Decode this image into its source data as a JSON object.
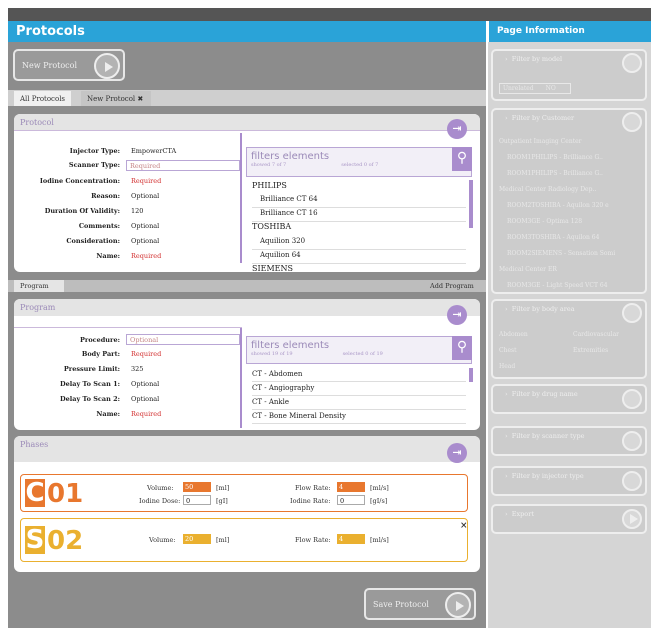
{
  "header": {
    "title": "Protocols",
    "side_title": "Page Information"
  },
  "toolbar": {
    "new_protocol": "New Protocol",
    "save_protocol": "Save Protocol"
  },
  "tabs": {
    "all": "All Protocols",
    "new": "New Protocol",
    "close": "✖",
    "program": "Program",
    "add_program": "Add Program"
  },
  "protocol": {
    "section_title": "Protocol",
    "fields": [
      {
        "label": "Injector Type:",
        "value": "EmpowerCTA"
      },
      {
        "label": "Scanner Type:",
        "value": "Required"
      },
      {
        "label": "Iodine Concentration:",
        "value": "Required"
      },
      {
        "label": "Reason:",
        "value": "Optional"
      },
      {
        "label": "Duration Of Validity:",
        "value": "120"
      },
      {
        "label": "Comments:",
        "value": "Optional"
      },
      {
        "label": "Consideration:",
        "value": "Optional"
      },
      {
        "label": "Name:",
        "value": "Required"
      }
    ],
    "filter": {
      "title": "filters elements",
      "showed": "showed 7 of 7",
      "selected": "selected 0 of 7"
    },
    "list": [
      "PHILIPS",
      "Brilliance CT 64",
      "Brilliance CT 16",
      "TOSHIBA",
      "Aquilion 320",
      "Aquilion 64",
      "SIEMENS"
    ]
  },
  "program": {
    "section_title": "Program",
    "fields": [
      {
        "label": "Procedure:",
        "value": "Optional"
      },
      {
        "label": "Body Part:",
        "value": "Required"
      },
      {
        "label": "Pressure Limit:",
        "value": "325"
      },
      {
        "label": "Delay To Scan 1:",
        "value": "Optional"
      },
      {
        "label": "Delay To Scan 2:",
        "value": "Optional"
      },
      {
        "label": "Name:",
        "value": "Required"
      }
    ],
    "filter": {
      "title": "filters elements",
      "showed": "showed 19 of 19",
      "selected": "selected 0 of 19"
    },
    "list": [
      "CT - Abdomen",
      "CT - Angiography",
      "CT - Ankle",
      "CT - Bone Mineral Density"
    ]
  },
  "phases": {
    "section_title": "Phases",
    "items": [
      {
        "letter": "C",
        "num": "01",
        "volume_label": "Volume:",
        "volume": "50",
        "volume_unit": "[ml]",
        "flow_label": "Flow Rate:",
        "flow": "4",
        "flow_unit": "[ml/s]",
        "iodine_dose_label": "Iodine Dose:",
        "iodine_dose": "0",
        "iodine_dose_unit": "[gI]",
        "iodine_rate_label": "Iodine Rate:",
        "iodine_rate": "0",
        "iodine_rate_unit": "[gI/s]"
      },
      {
        "letter": "S",
        "num": "02",
        "volume_label": "Volume:",
        "volume": "20",
        "volume_unit": "[ml]",
        "flow_label": "Flow Rate:",
        "flow": "4",
        "flow_unit": "[ml/s]",
        "close": "×"
      }
    ]
  },
  "sidebar": {
    "filter_model": "Filter by model",
    "unrelated": "Unrelated",
    "unrelated_val": "NO",
    "filter_customer": "Filter by Customer",
    "customer_list": [
      "Outpatient Imaging Center",
      "ROOM1PHILIPS - Brilliance G..",
      "ROOM1PHILIPS - Brilliance G..",
      "Medical Center Radiology Dep..",
      "ROOM2TOSHIBA - Aquilon 320 e",
      "ROOM3GE - Optima 128",
      "ROOM3TOSHIBA - Aquilon 64",
      "ROOM2SIEMENS - Sensation Somi",
      "Medical Center ER",
      "ROOM3GE - Light Speed VCT 64"
    ],
    "filter_body": "Filter by body area",
    "body_list": [
      "Abdomen",
      "Cardiovascular",
      "Chest",
      "Extremities",
      "Head"
    ],
    "filter_drug": "Filter by drug name",
    "filter_scanner": "Filter by scanner type",
    "filter_injector": "Filter by injector type",
    "export": "Export"
  },
  "colors": {
    "accent": "#2aa3d8",
    "purple": "#a98ccd",
    "phase_c": "#e8772e",
    "phase_s": "#eab02f"
  }
}
